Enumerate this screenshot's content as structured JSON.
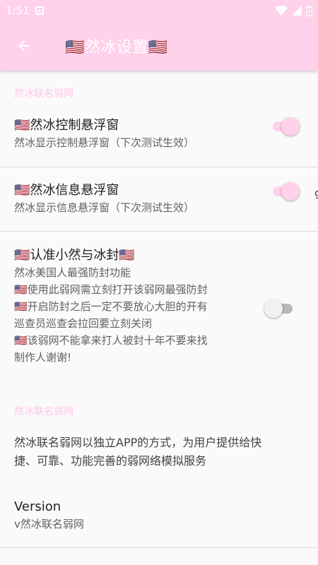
{
  "status": {
    "time": "1:51"
  },
  "toolbar": {
    "title": "🇺🇸然冰设置🇺🇸"
  },
  "categories": {
    "first": "然冰联名弱网",
    "second": "然冰联名弱网"
  },
  "prefs": [
    {
      "title": "🇺🇸然冰控制悬浮窗",
      "summary": "然冰显示控制悬浮窗（下次测试生效）",
      "enabled": true
    },
    {
      "title": "🇺🇸然冰信息悬浮窗",
      "summary": "然冰显示信息悬浮窗（下次测试生效）",
      "enabled": true
    },
    {
      "title": "🇺🇸认准小然与冰封🇺🇸",
      "summary_lines": [
        "然冰美国人最强防封功能",
        "🇺🇸使用此弱网需立刻打开该弱网最强防封",
        "🇺🇸开启防封之后一定不要放心大胆的开有",
        "巡查员巡查会拉回要立刻关闭",
        "🇺🇸该弱网不能拿来打人被封十年不要来找",
        "制作人谢谢!"
      ],
      "enabled": false
    }
  ],
  "about": {
    "description_lines": [
      "然冰联名弱网以独立APP的方式，为用户提供给快",
      "捷、可靠、功能完善的弱网络模拟服务"
    ],
    "version_title": "Version",
    "version_value": "v然冰联名弱网"
  },
  "edge_char": "g",
  "colors": {
    "accent": "#ffd1ea",
    "category": "#ffc8e6",
    "background": "#fafafa"
  },
  "icons": {
    "back": "arrow-left-icon",
    "wifi": "wifi-icon",
    "signal": "signal-icon",
    "battery": "battery-icon",
    "notification": "app-notification-icon"
  }
}
